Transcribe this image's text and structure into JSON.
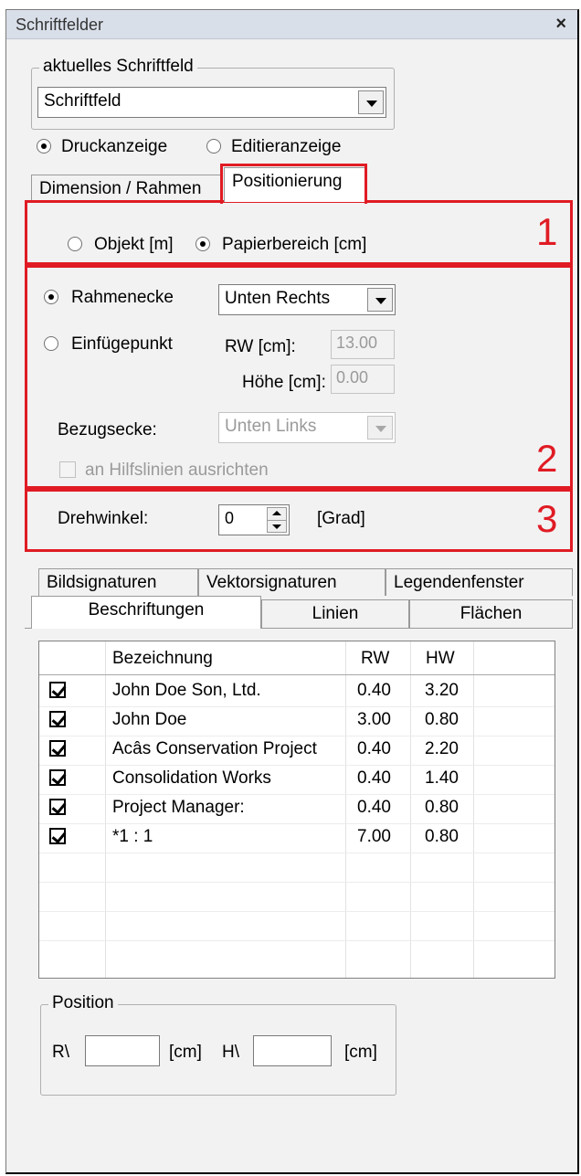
{
  "window": {
    "title": "Schriftfelder",
    "close_glyph": "×"
  },
  "current_field": {
    "legend": "aktuelles Schriftfeld",
    "value": "Schriftfeld"
  },
  "display_mode": {
    "print_label": "Druckanzeige",
    "edit_label": "Editieranzeige",
    "selected": "print"
  },
  "top_tabs": [
    {
      "label": "Dimension / Rahmen",
      "active": false
    },
    {
      "label": "Positionierung",
      "active": true
    }
  ],
  "section1": {
    "number": "1",
    "object_label": "Objekt [m]",
    "paper_label": "Papierbereich [cm]",
    "selected": "paper"
  },
  "section2": {
    "number": "2",
    "frame_corner_label": "Rahmenecke",
    "frame_corner_value": "Unten Rechts",
    "insert_point_label": "Einfügepunkt",
    "rw_label": "RW [cm]:",
    "rw_value": "13.00",
    "height_label": "Höhe [cm]:",
    "height_value": "0.00",
    "ref_corner_label": "Bezugsecke:",
    "ref_corner_value": "Unten Links",
    "guides_label": "an Hilfslinien ausrichten",
    "selected": "frame_corner"
  },
  "section3": {
    "number": "3",
    "rotation_label": "Drehwinkel:",
    "rotation_value": "0",
    "unit_label": "[Grad]"
  },
  "bottom_tabs_back": [
    {
      "label": "Bildsignaturen"
    },
    {
      "label": "Vektorsignaturen"
    },
    {
      "label": "Legendenfenster"
    }
  ],
  "bottom_tabs_front": [
    {
      "label": "Beschriftungen",
      "active": true
    },
    {
      "label": "Linien",
      "active": false
    },
    {
      "label": "Flächen",
      "active": false
    }
  ],
  "table": {
    "headers": [
      "",
      "Bezeichnung",
      "RW",
      "HW",
      ""
    ],
    "rows": [
      {
        "checked": true,
        "name": "John Doe  Son, Ltd.",
        "rw": "0.40",
        "hw": "3.20"
      },
      {
        "checked": true,
        "name": "John Doe",
        "rw": "3.00",
        "hw": "0.80"
      },
      {
        "checked": true,
        "name": "Acâs Conservation Project",
        "rw": "0.40",
        "hw": "2.20"
      },
      {
        "checked": true,
        "name": "Consolidation Works",
        "rw": "0.40",
        "hw": "1.40"
      },
      {
        "checked": true,
        "name": "Project Manager:",
        "rw": "0.40",
        "hw": "0.80"
      },
      {
        "checked": true,
        "name": "*1 : 1",
        "rw": "7.00",
        "hw": "0.80"
      }
    ]
  },
  "position": {
    "legend": "Position",
    "rw_label": "R\\",
    "rw_value": "",
    "rw_unit": "[cm]",
    "hw_label": "H\\",
    "hw_value": "",
    "hw_unit": "[cm]"
  },
  "colors": {
    "highlight": "#e01b24",
    "title_bar": "#d9dfe9"
  }
}
